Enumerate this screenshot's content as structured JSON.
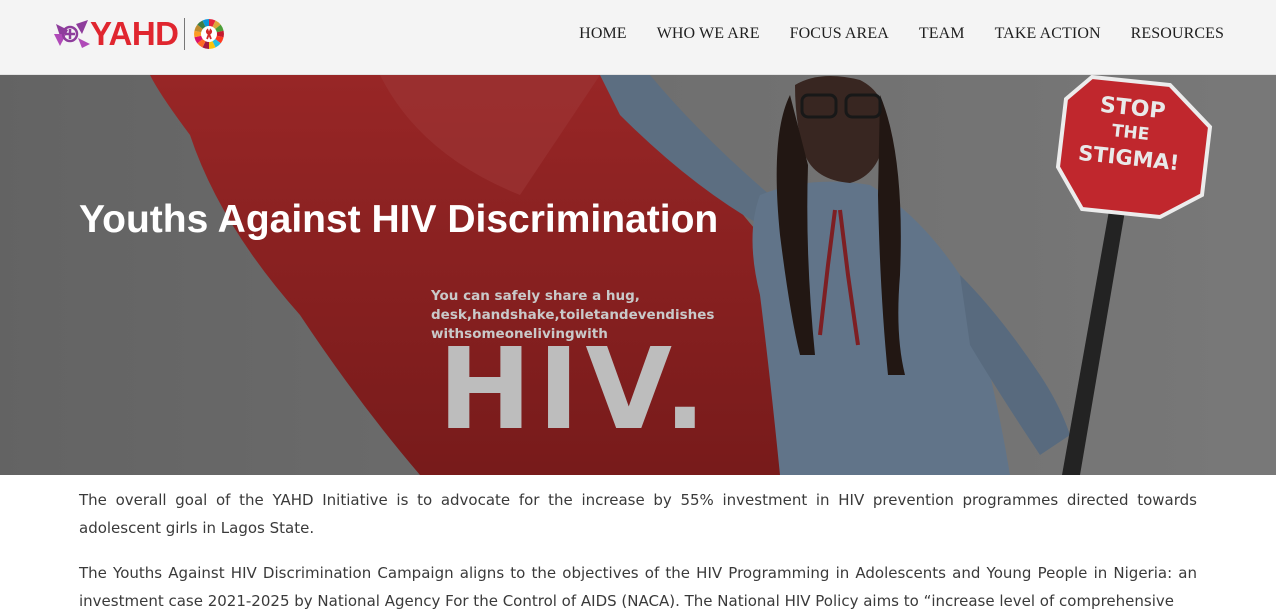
{
  "brand": {
    "logo_text": "YAHD",
    "logo_color": "#e0262f",
    "logo_mark_color": "#8e3d9c",
    "icons": [
      "people-ribbon-icon",
      "sdg-wheel-icon"
    ]
  },
  "nav": {
    "items": [
      {
        "label": "HOME"
      },
      {
        "label": "WHO WE ARE"
      },
      {
        "label": "FOCUS AREA"
      },
      {
        "label": "TEAM"
      },
      {
        "label": "TAKE ACTION"
      },
      {
        "label": "RESOURCES"
      }
    ]
  },
  "hero": {
    "title": "Youths Against HIV Discrimination",
    "caption_lines": [
      "You can safely share a hug,",
      "desk,handshake,toiletandevendishes",
      "withsomeonelivingwith"
    ],
    "big_text": "HIV.",
    "sign_lines": [
      "STOP",
      "THE",
      "STIGMA!"
    ],
    "accent_color": "#d32a2a"
  },
  "content": {
    "paragraphs": [
      "The overall goal of the YAHD Initiative is to advocate for the increase by 55% investment in HIV prevention programmes directed towards adolescent girls in Lagos State.",
      " The Youths Against HIV Discrimination Campaign aligns to the objectives of the HIV Programming in Adolescents and Young People in Nigeria: an investment case 2021-2025 by National Agency For the Control of AIDS (NACA). The National HIV Policy aims to “increase level of comprehensive"
    ]
  }
}
